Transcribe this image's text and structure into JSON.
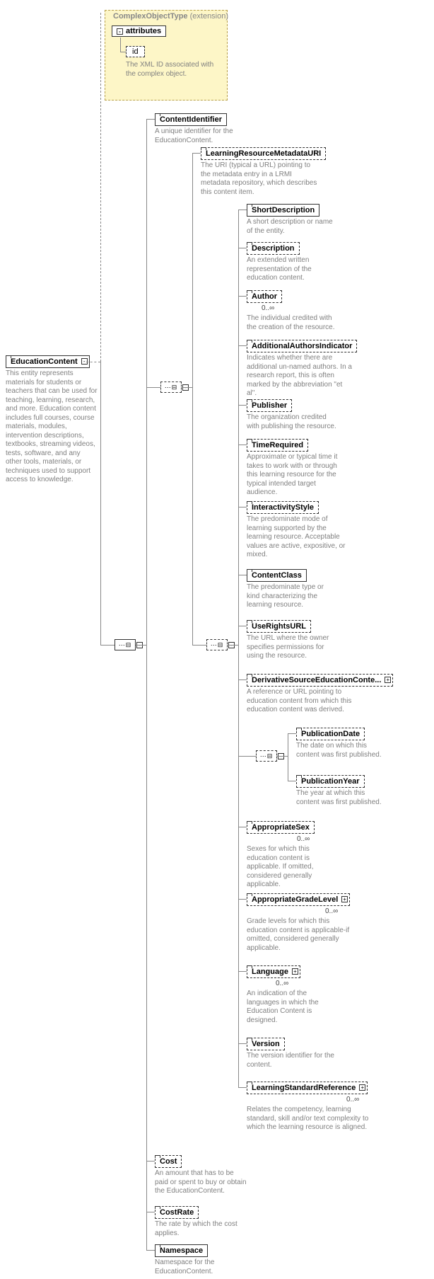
{
  "extension": {
    "title": "ComplexObjectType",
    "suffix": "(extension)",
    "attributes_label": "attributes",
    "id_label": "id",
    "id_desc": "The XML ID associated with the complex object."
  },
  "root": {
    "name": "EducationContent",
    "desc": "This entity represents materials for students or teachers that can be used for teaching, learning, research, and more. Education content includes full courses, course materials, modules, intervention descriptions, textbooks, streaming videos, tests, software, and any other tools, materials, or techniques used to support access to knowledge."
  },
  "level1": {
    "content_identifier": {
      "name": "ContentIdentifier",
      "desc": "A unique identifier for the EducationContent."
    },
    "cost": {
      "name": "Cost",
      "desc": "An amount that has to be paid or spent to buy or obtain the EducationContent."
    },
    "cost_rate": {
      "name": "CostRate",
      "desc": "The rate by which the cost applies."
    },
    "namespace": {
      "name": "Namespace",
      "desc": "Namespace for the EducationContent."
    }
  },
  "level2": {
    "lrm_uri": {
      "name": "LearningResourceMetadataURI",
      "desc": "The URI (typical a URL) pointing to the metadata entry in a LRMI metadata repository, which describes this content item."
    }
  },
  "level3": {
    "short_description": {
      "name": "ShortDescription",
      "desc": "A short description or name of the entity."
    },
    "description": {
      "name": "Description",
      "desc": "An extended written representation of the education content."
    },
    "author": {
      "name": "Author",
      "card": "0..∞",
      "desc": "The individual credited with the creation of the resource."
    },
    "additional_authors": {
      "name": "AdditionalAuthorsIndicator",
      "desc": "Indicates whether there are additional un-named authors. In a research report, this is often marked by the abbreviation \"et al\"."
    },
    "publisher": {
      "name": "Publisher",
      "desc": "The organization credited with publishing the resource."
    },
    "time_required": {
      "name": "TimeRequired",
      "desc": "Approximate or typical time it takes to work with or through this learning resource for the typical intended target audience."
    },
    "interactivity": {
      "name": "InteractivityStyle",
      "desc": "The predominate mode of learning supported by the learning resource. Acceptable values are active, expositive, or mixed."
    },
    "content_class": {
      "name": "ContentClass",
      "desc": "The predominate type or kind characterizing the learning resource."
    },
    "use_rights": {
      "name": "UseRightsURL",
      "desc": "The URL where the owner specifies permissions for using the resource."
    },
    "derivative": {
      "name": "DerivativeSourceEducationConte...",
      "desc": "A reference or URL pointing to education content from which this education content was derived."
    },
    "appropriate_sex": {
      "name": "AppropriateSex",
      "card": "0..∞",
      "desc": "Sexes for which this education content is applicable. If omitted, considered generally applicable."
    },
    "appropriate_grade": {
      "name": "AppropriateGradeLevel",
      "card": "0..∞",
      "desc": "Grade levels for which this education content is applicable-if omitted, considered generally applicable."
    },
    "language": {
      "name": "Language",
      "card": "0..∞",
      "desc": "An indication of the languages in which the Education Content is designed."
    },
    "version": {
      "name": "Version",
      "desc": "The version identifier for the content."
    },
    "learning_standard": {
      "name": "LearningStandardReference",
      "card": "0..∞",
      "desc": "Relates the competency, learning standard, skill and/or text complexity to which the learning resource is aligned."
    }
  },
  "level4": {
    "pub_date": {
      "name": "PublicationDate",
      "desc": "The date on which this content was first published."
    },
    "pub_year": {
      "name": "PublicationYear",
      "desc": "The year at which this content was first published."
    }
  }
}
